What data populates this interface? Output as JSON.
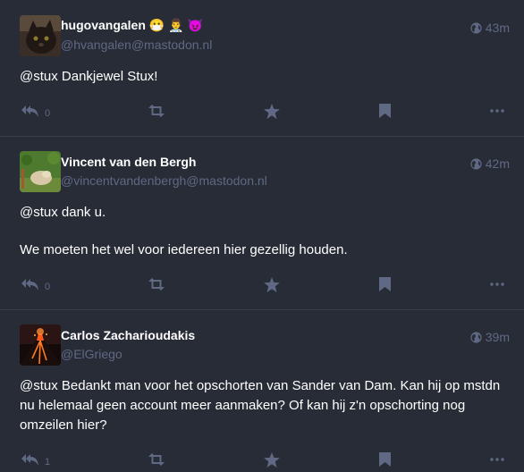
{
  "statuses": [
    {
      "display_name": "hugovangalen",
      "emojis": [
        "😷",
        "👨‍⚕️",
        "😈"
      ],
      "acct": "@hvangalen@mastodon.nl",
      "time": "43m",
      "visibility_icon": "globe-icon",
      "paragraphs": [
        "@stux Dankjewel Stux!"
      ],
      "reply_count": "0"
    },
    {
      "display_name": "Vincent van den Bergh",
      "emojis": [],
      "acct": "@vincentvandenbergh@mastodon.nl",
      "time": "42m",
      "visibility_icon": "globe-icon",
      "paragraphs": [
        "@stux dank u.",
        "We moeten het wel voor iedereen hier gezellig houden."
      ],
      "reply_count": "0"
    },
    {
      "display_name": "Carlos Zacharioudakis",
      "emojis": [],
      "acct": "@ElGriego",
      "time": "39m",
      "visibility_icon": "globe-icon",
      "paragraphs": [
        "@stux Bedankt man voor het opschorten van Sander van Dam. Kan hij op mstdn nu helemaal geen account meer aanmaken? Of kan hij z'n opschorting nog omzeilen hier?"
      ],
      "reply_count": "1"
    }
  ],
  "colors": {
    "background": "#282c37",
    "muted": "#606984",
    "text": "#ffffff",
    "divider": "#393f4f"
  }
}
